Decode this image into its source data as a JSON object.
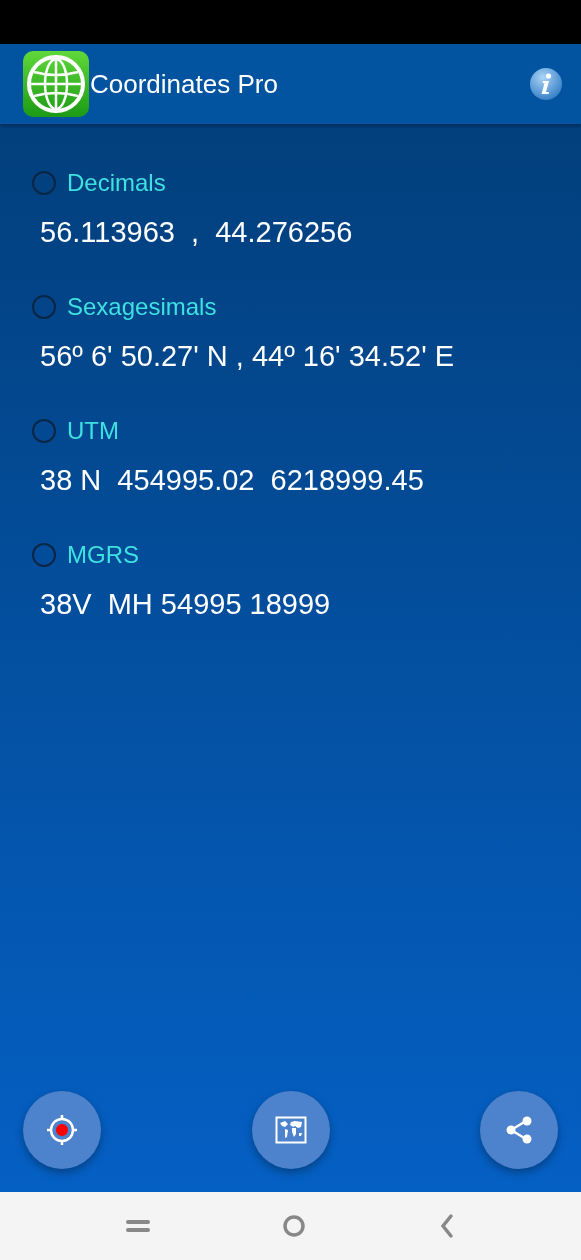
{
  "app_bar": {
    "title": "Coordinates Pro"
  },
  "formats": [
    {
      "label": "Decimals",
      "selected": false,
      "value": "56.113963  ,  44.276256"
    },
    {
      "label": "Sexagesimals",
      "selected": false,
      "value": "56º 6' 50.27' N , 44º 16' 34.52' E"
    },
    {
      "label": "UTM",
      "selected": false,
      "value": "38 N  454995.02  6218999.45"
    },
    {
      "label": "MGRS",
      "selected": false,
      "value": "38V  MH 54995 18999"
    }
  ]
}
